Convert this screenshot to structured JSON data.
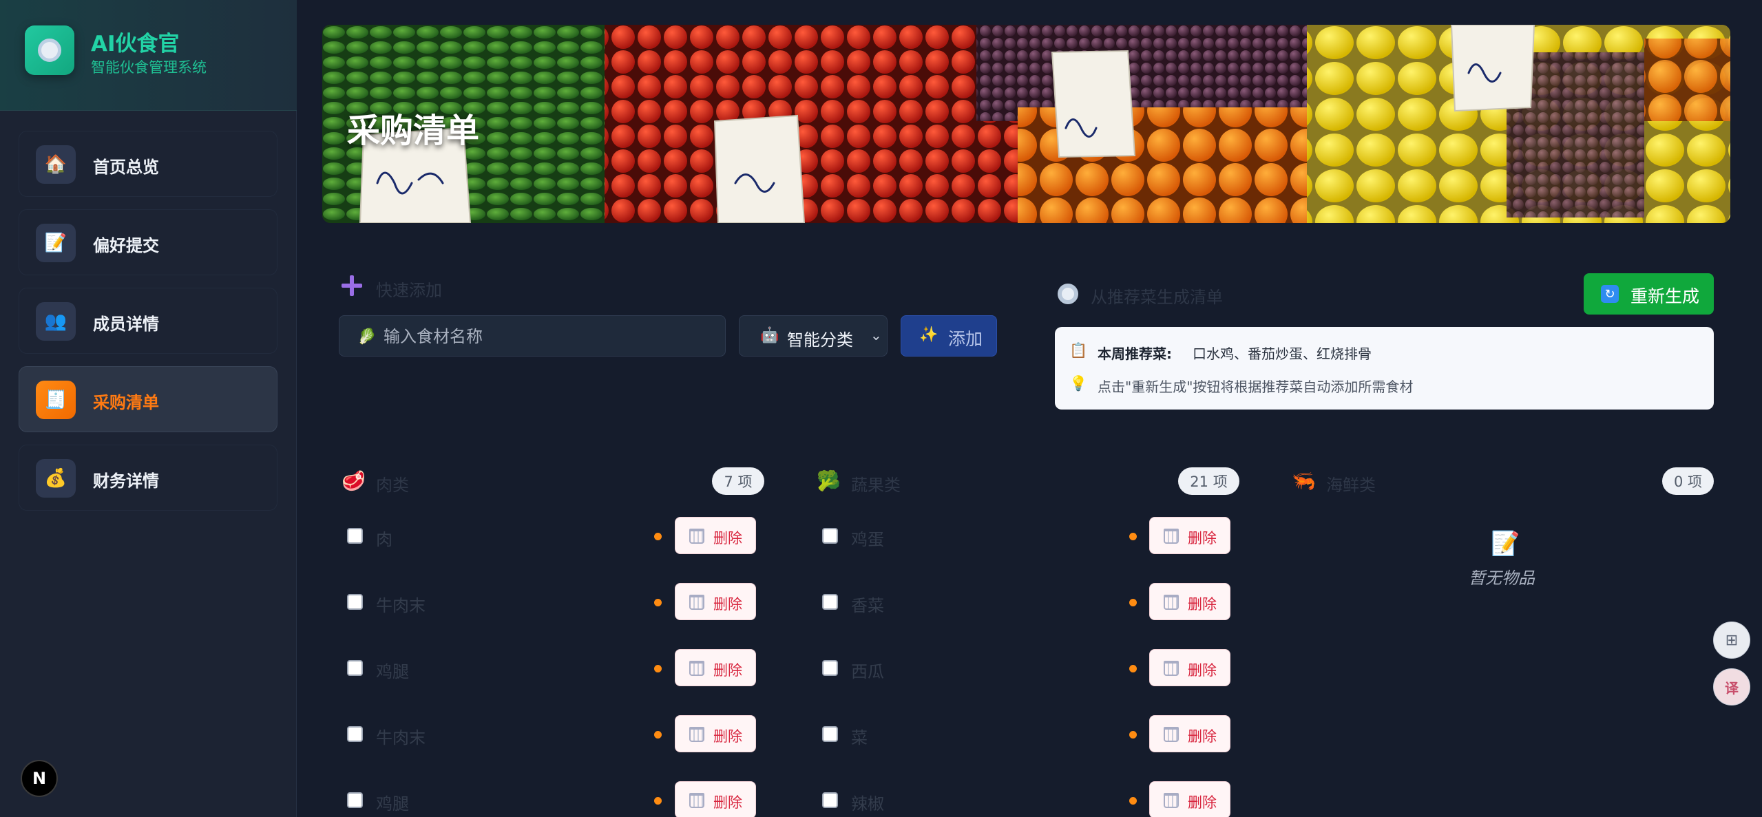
{
  "brand": {
    "name": "AI伙食官",
    "subtitle": "智能伙食管理系统"
  },
  "nav": [
    {
      "label": "首页总览",
      "icon": "house-icon",
      "glyph": "🏠",
      "active": false
    },
    {
      "label": "偏好提交",
      "icon": "document-icon",
      "glyph": "📝",
      "active": false
    },
    {
      "label": "成员详情",
      "icon": "members-icon",
      "glyph": "👥",
      "active": false
    },
    {
      "label": "采购清单",
      "icon": "receipt-icon",
      "glyph": "🧾",
      "active": true
    },
    {
      "label": "财务详情",
      "icon": "money-bag-icon",
      "glyph": "💰",
      "active": false
    }
  ],
  "banner": {
    "title": "采购清单"
  },
  "quick_add": {
    "title": "快速添加",
    "input_placeholder": "输入食材名称",
    "category_select": "智能分类",
    "add_label": "添加"
  },
  "recommend": {
    "title": "从推荐菜生成清单",
    "regen_label": "重新生成",
    "weekly_label": "本周推荐菜:",
    "weekly_dishes": "口水鸡、番茄炒蛋、红烧排骨",
    "hint": "点击\"重新生成\"按钮将根据推荐菜自动添加所需食材"
  },
  "delete_label": "删除",
  "categories": [
    {
      "name": "肉类",
      "icon": "meat-icon",
      "glyph": "🥩",
      "count": "7 项",
      "items": [
        "肉",
        "牛肉末",
        "鸡腿",
        "牛肉末",
        "鸡腿"
      ]
    },
    {
      "name": "蔬果类",
      "icon": "broccoli-icon",
      "glyph": "🥦",
      "count": "21 项",
      "items": [
        "鸡蛋",
        "香菜",
        "西瓜",
        "菜",
        "辣椒"
      ]
    },
    {
      "name": "海鲜类",
      "icon": "shrimp-icon",
      "glyph": "🦐",
      "count": "0 项",
      "items": []
    }
  ],
  "empty_state": "暂无物品",
  "next_badge": "N",
  "colors": {
    "accent_orange": "#ff7a12",
    "brand_teal": "#22d3a6",
    "regen_green": "#10a83c",
    "add_blue": "#1f3f8d",
    "delete_red": "#d8253e"
  }
}
